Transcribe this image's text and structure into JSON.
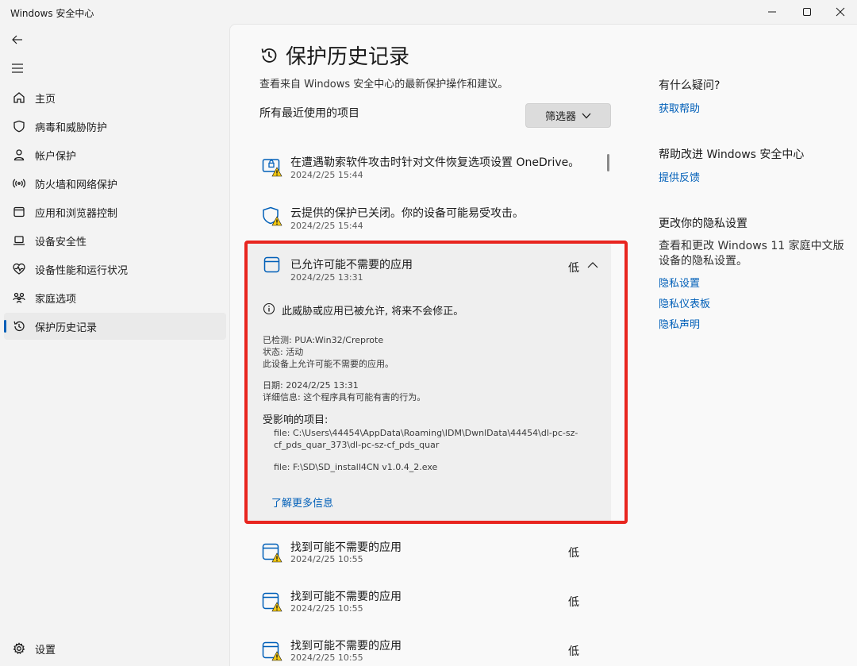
{
  "window": {
    "title": "Windows 安全中心"
  },
  "nav": {
    "items": [
      {
        "label": "主页",
        "icon": "home-icon"
      },
      {
        "label": "病毒和威胁防护",
        "icon": "shield-icon"
      },
      {
        "label": "帐户保护",
        "icon": "person-icon"
      },
      {
        "label": "防火墙和网络保护",
        "icon": "wifi-icon"
      },
      {
        "label": "应用和浏览器控制",
        "icon": "app-window-icon"
      },
      {
        "label": "设备安全性",
        "icon": "laptop-icon"
      },
      {
        "label": "设备性能和运行状况",
        "icon": "heart-pulse-icon"
      },
      {
        "label": "家庭选项",
        "icon": "family-icon"
      },
      {
        "label": "保护历史记录",
        "icon": "history-icon"
      }
    ],
    "settings_label": "设置"
  },
  "main": {
    "title": "保护历史记录",
    "subtitle": "查看来自 Windows 安全中心的最新保护操作和建议。",
    "section_label": "所有最近使用的项目",
    "filter_label": "筛选器",
    "items": [
      {
        "title": "在遭遇勒索软件攻击时针对文件恢复选项设置 OneDrive。",
        "date": "2024/2/25 15:44",
        "icon": "ransomware-warning-icon"
      },
      {
        "title": "云提供的保护已关闭。你的设备可能易受攻击。",
        "date": "2024/2/25 15:44",
        "icon": "shield-warning-icon"
      }
    ],
    "expanded": {
      "title": "已允许可能不需要的应用",
      "date": "2024/2/25 13:31",
      "severity": "低",
      "info": "此威胁或应用已被允许, 将来不会修正。",
      "detected": "已检测:  PUA:Win32/Creprote",
      "status": "状态:  活动",
      "status_desc": "此设备上允许可能不需要的应用。",
      "date_line": "日期:  2024/2/25 13:31",
      "details": "详细信息:  这个程序具有可能有害的行为。",
      "affected_label": "受影响的项目:",
      "file1_line1": "file: C:\\Users\\44454\\AppData\\Roaming\\IDM\\DwnlData\\44454\\dl-pc-sz-",
      "file1_line2": "cf_pds_quar_373\\dl-pc-sz-cf_pds_quar",
      "file2": "file: F:\\SD\\SD_install4CN v1.0.4_2.exe",
      "learn_more": "了解更多信息"
    },
    "found_items": [
      {
        "title": "找到可能不需要的应用",
        "date": "2024/2/25 10:55",
        "severity": "低"
      },
      {
        "title": "找到可能不需要的应用",
        "date": "2024/2/25 10:55",
        "severity": "低"
      },
      {
        "title": "找到可能不需要的应用",
        "date": "2024/2/25 10:55",
        "severity": "低"
      }
    ]
  },
  "side": {
    "q_heading": "有什么疑问?",
    "q_link": "获取帮助",
    "improve_heading": "帮助改进 Windows 安全中心",
    "improve_link": "提供反馈",
    "privacy_heading": "更改你的隐私设置",
    "privacy_desc_1": "查看和更改 Windows 11 家庭中文版",
    "privacy_desc_2": "设备的隐私设置。",
    "privacy_links": [
      "隐私设置",
      "隐私仪表板",
      "隐私声明"
    ]
  },
  "colors": {
    "accent": "#005fb8",
    "highlight_box": "#e8251f",
    "warning": "#f2c811"
  }
}
